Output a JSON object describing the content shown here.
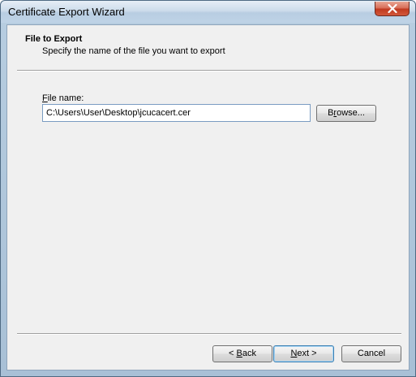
{
  "window": {
    "title": "Certificate Export Wizard",
    "close_icon": "close-icon"
  },
  "page": {
    "title": "File to Export",
    "description": "Specify the name of the file you want to export"
  },
  "file_name": {
    "label_first_letter": "F",
    "label_rest": "ile name:",
    "value": "C:\\Users\\User\\Desktop\\jcucacert.cer"
  },
  "buttons": {
    "browse_first": "B",
    "browse_underlined": "r",
    "browse_rest": "owse...",
    "back_prefix": "< ",
    "back_underlined": "B",
    "back_rest": "ack",
    "next_underlined": "N",
    "next_rest": "ext >",
    "cancel": "Cancel"
  },
  "colors": {
    "close_button": "#c0391f",
    "default_button_border": "#3c7fb1"
  }
}
